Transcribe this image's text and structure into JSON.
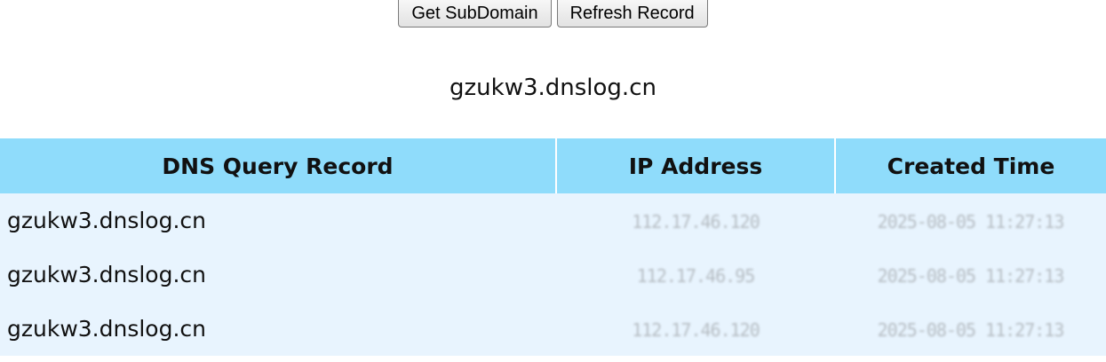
{
  "toolbar": {
    "get_subdomain_label": "Get SubDomain",
    "refresh_record_label": "Refresh Record"
  },
  "subdomain": "gzukw3.dnslog.cn",
  "table": {
    "headers": {
      "record": "DNS Query Record",
      "ip": "IP Address",
      "time": "Created Time"
    },
    "rows": [
      {
        "record": "gzukw3.dnslog.cn",
        "ip": "112.17.46.120",
        "time": "2025-08-05 11:27:13"
      },
      {
        "record": "gzukw3.dnslog.cn",
        "ip": "112.17.46.95",
        "time": "2025-08-05 11:27:13"
      },
      {
        "record": "gzukw3.dnslog.cn",
        "ip": "112.17.46.120",
        "time": "2025-08-05 11:27:13"
      }
    ]
  }
}
